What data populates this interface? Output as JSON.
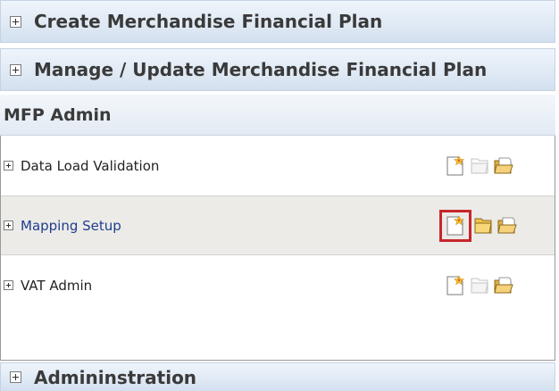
{
  "sections": {
    "create_plan": {
      "label": "Create Merchandise Financial Plan"
    },
    "manage_plan": {
      "label": "Manage / Update Merchandise Financial Plan"
    },
    "admin": {
      "label": "MFP Admin"
    },
    "administration": {
      "label": "Admininstration"
    }
  },
  "admin_items": [
    {
      "label": "Data Load Validation",
      "open_enabled": false
    },
    {
      "label": "Mapping Setup",
      "open_enabled": true,
      "selected": true
    },
    {
      "label": "VAT Admin",
      "open_enabled": false
    }
  ],
  "icons": {
    "new": "new-workbook-icon",
    "open": "open-workbook-icon",
    "folder": "open-folder-icon"
  },
  "colors": {
    "header_bg": "#dfe9f4",
    "link": "#1f3d8c",
    "highlight": "#c8262b",
    "selected_row": "#ecebe8"
  }
}
